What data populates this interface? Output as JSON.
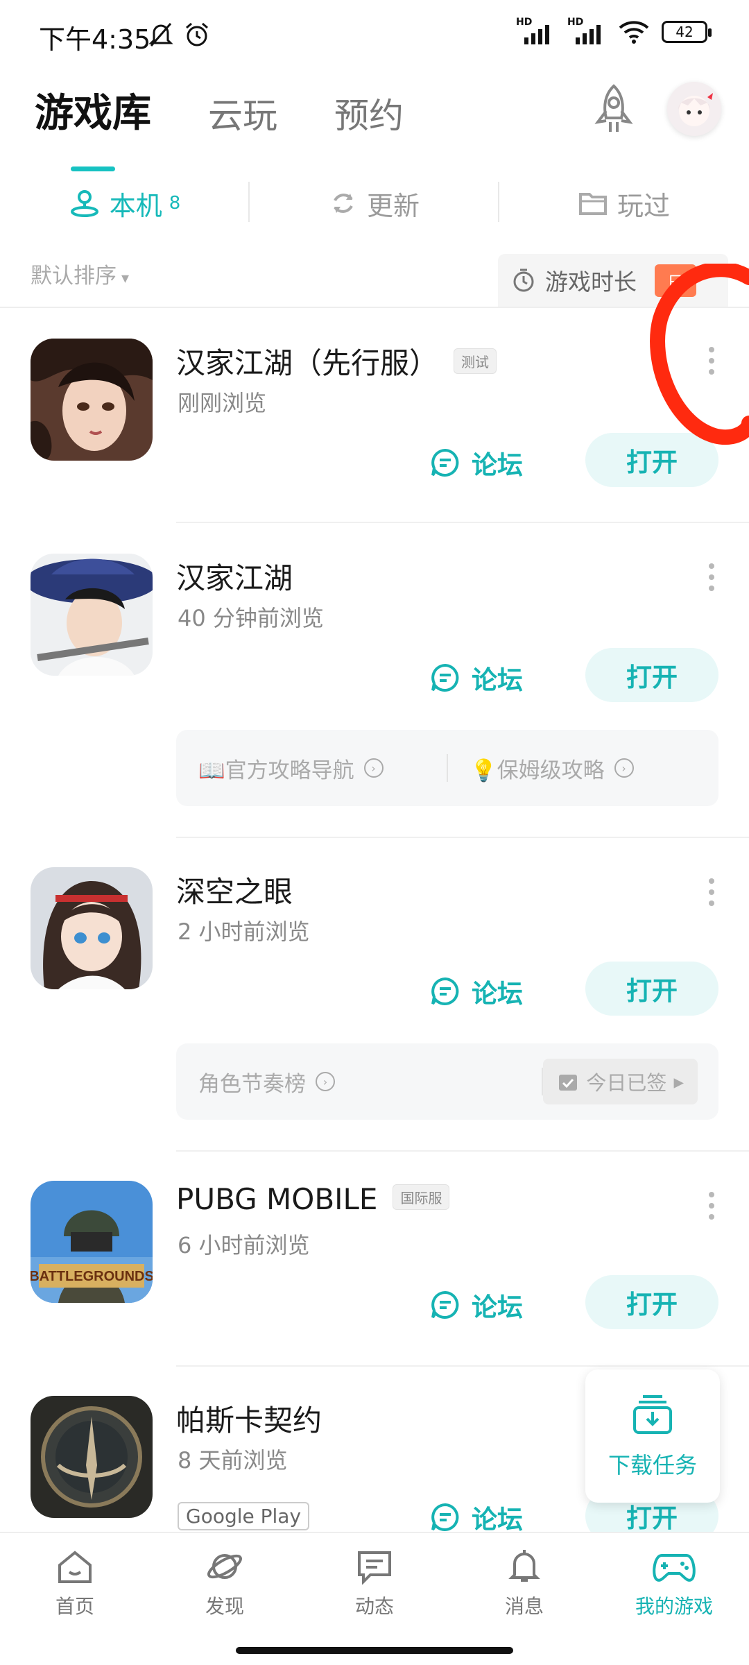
{
  "status_bar": {
    "time": "下午4:35",
    "battery": "42",
    "signal_label": "HD"
  },
  "header": {
    "tabs": [
      {
        "label": "游戏库",
        "active": true
      },
      {
        "label": "云玩",
        "active": false
      },
      {
        "label": "预约",
        "active": false
      }
    ]
  },
  "sub_tabs": [
    {
      "label": "本机",
      "count": "8",
      "icon": "location-person-icon",
      "active": true
    },
    {
      "label": "更新",
      "icon": "refresh-icon",
      "active": false
    },
    {
      "label": "玩过",
      "icon": "folder-icon",
      "active": false
    }
  ],
  "sort": {
    "label": "默认排序"
  },
  "playtime": {
    "label": "游戏时长",
    "badge": "日"
  },
  "games": [
    {
      "title": "汉家江湖（先行服）",
      "badge": "测试",
      "time": "刚刚浏览",
      "forum_label": "论坛",
      "open_label": "打开"
    },
    {
      "title": "汉家江湖",
      "time": "40 分钟前浏览",
      "forum_label": "论坛",
      "open_label": "打开",
      "strategy": [
        "📖官方攻略导航",
        "💡保姆级攻略"
      ]
    },
    {
      "title": "深空之眼",
      "time": "2 小时前浏览",
      "forum_label": "论坛",
      "open_label": "打开",
      "strategy": [
        "角色节奏榜"
      ],
      "checkin": "今日已签"
    },
    {
      "title": "PUBG MOBILE",
      "badge": "国际服",
      "time": "6 小时前浏览",
      "forum_label": "论坛",
      "open_label": "打开"
    },
    {
      "title": "帕斯卡契约",
      "time": "8 天前浏览",
      "store_badge": "Google Play",
      "forum_label": "论坛",
      "open_label": "打开"
    }
  ],
  "download_float": {
    "label": "下载任务"
  },
  "bottom_nav": [
    {
      "label": "首页",
      "icon": "home-icon",
      "active": false
    },
    {
      "label": "发现",
      "icon": "planet-icon",
      "active": false
    },
    {
      "label": "动态",
      "icon": "chat-icon",
      "active": false
    },
    {
      "label": "消息",
      "icon": "bell-icon",
      "active": false
    },
    {
      "label": "我的游戏",
      "icon": "gamepad-icon",
      "active": true
    }
  ],
  "colors": {
    "accent": "#16b3b3",
    "badge_orange": "#ff7b50",
    "annotation_red": "#ff2a0f"
  }
}
